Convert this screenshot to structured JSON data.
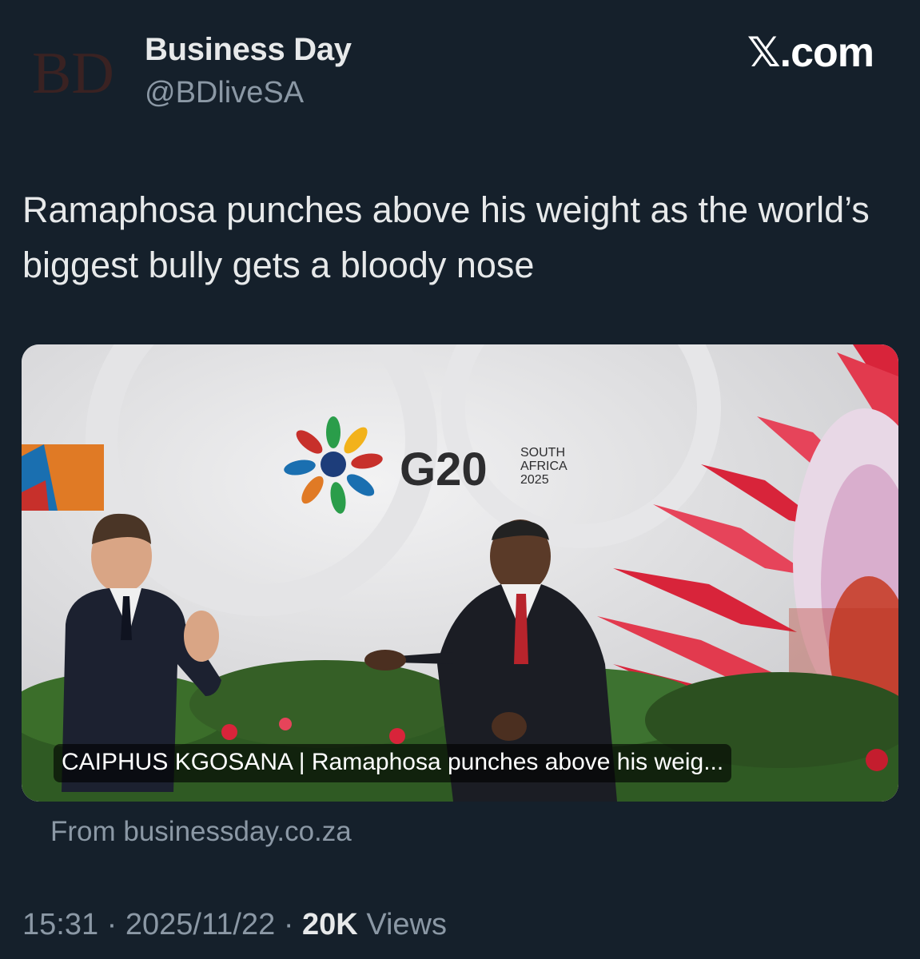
{
  "author": {
    "logo_text": "BD",
    "name": "Business Day",
    "handle": "@BDliveSA"
  },
  "brand": "𝕏.com",
  "tweet": {
    "text": "Ramaphosa punches above his weight as the world’s biggest bully gets a bloody nose"
  },
  "card": {
    "caption": "CAIPHUS KGOSANA | Ramaphosa punches above his weig...",
    "source": "From businessday.co.za",
    "backdrop": {
      "g20_title": "G20",
      "g20_line1": "SOUTH",
      "g20_line2": "AFRICA",
      "g20_line3": "2025"
    }
  },
  "meta": {
    "time": "15:31",
    "separator": "·",
    "date": "2025/11/22",
    "views_count": "20K",
    "views_label": "Views"
  },
  "colors": {
    "background": "#15202b",
    "primary_text": "#e7e9ea",
    "secondary_text": "#8b98a5",
    "logo_red": "#c4161c"
  }
}
